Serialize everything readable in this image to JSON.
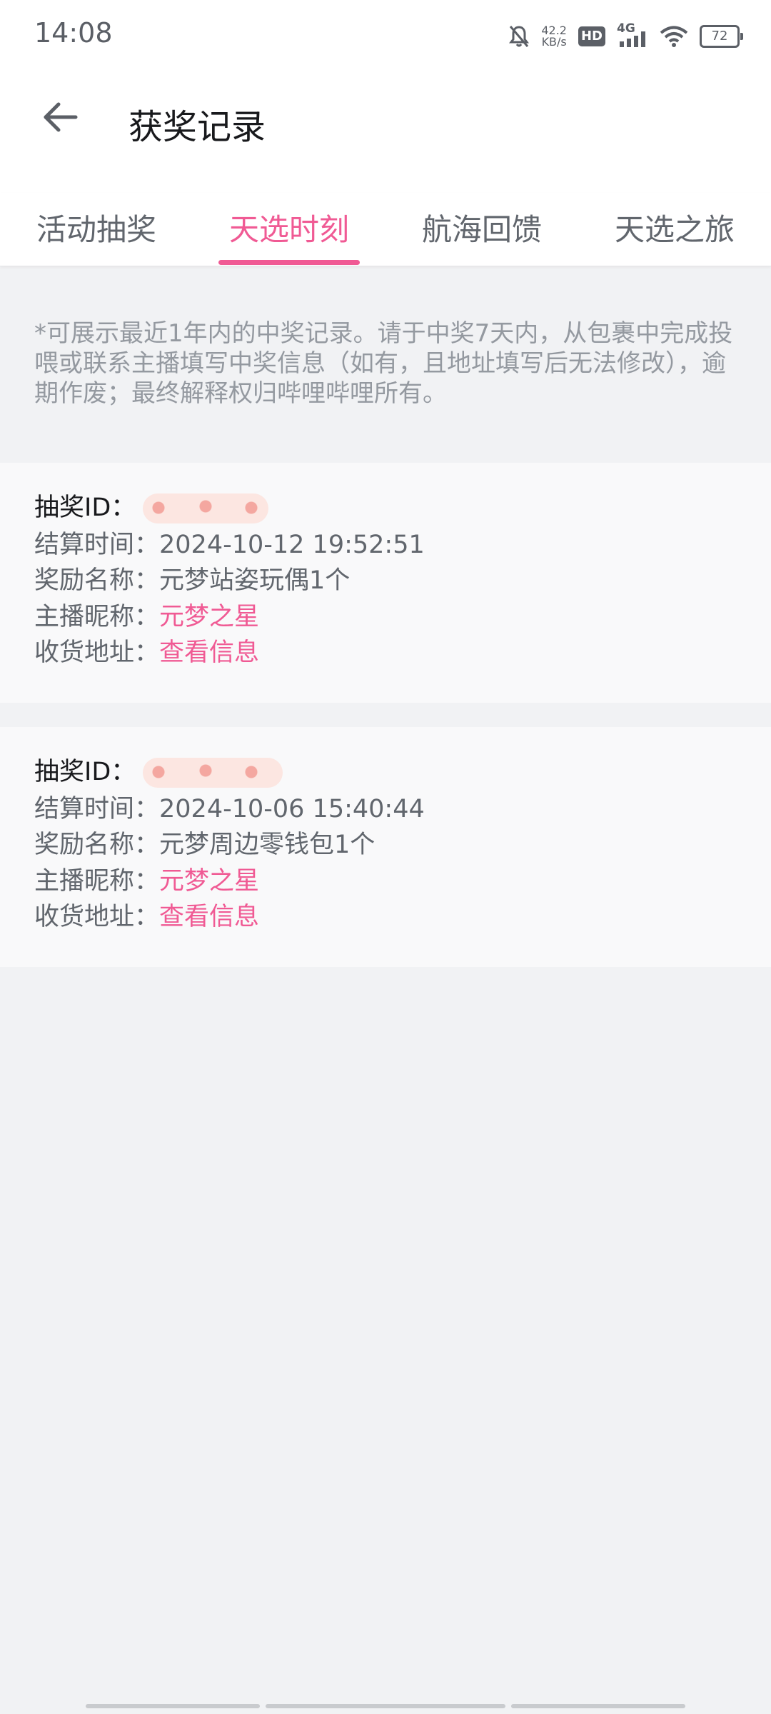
{
  "status_bar": {
    "time": "14:08",
    "speed_value": "42.2",
    "speed_unit": "KB/s",
    "hd": "HD",
    "network": "4G",
    "battery": "72"
  },
  "header": {
    "title": "获奖记录"
  },
  "tabs": [
    {
      "label": "活动抽奖"
    },
    {
      "label": "天选时刻"
    },
    {
      "label": "航海回馈"
    },
    {
      "label": "天选之旅"
    }
  ],
  "notice": "*可展示最近1年内的中奖记录。请于中奖7天内，从包裹中完成投喂或联系主播填写中奖信息（如有，且地址填写后无法修改），逾期作废；最终解释权归哔哩哔哩所有。",
  "labels": {
    "lottery_id": "抽奖ID：",
    "settle_time": "结算时间：",
    "reward_name": "奖励名称：",
    "anchor_nickname": "主播昵称：",
    "address": "收货地址："
  },
  "records": [
    {
      "settle_time": "2024-10-12 19:52:51",
      "reward_name": "元梦站姿玩偶1个",
      "anchor_nickname": "元梦之星",
      "address_link": "查看信息"
    },
    {
      "settle_time": "2024-10-06 15:40:44",
      "reward_name": "元梦周边零钱包1个",
      "anchor_nickname": "元梦之星",
      "address_link": "查看信息"
    }
  ],
  "colors": {
    "accent": "#f05a94",
    "background": "#f1f2f4",
    "card": "#f9f9fa"
  }
}
